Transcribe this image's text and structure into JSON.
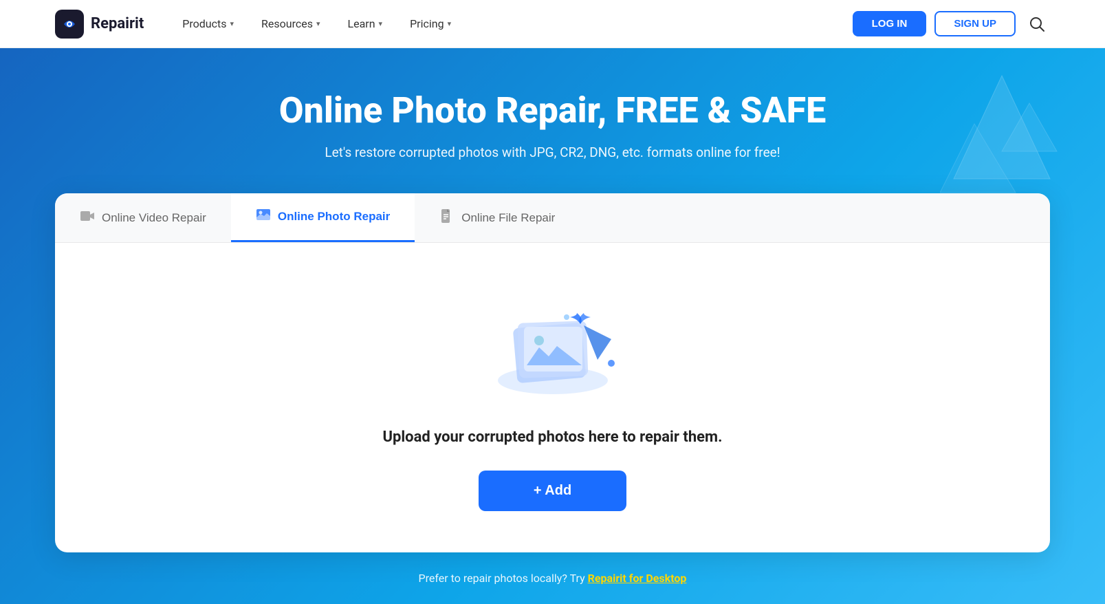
{
  "navbar": {
    "brand_name": "Repairit",
    "nav_items": [
      {
        "id": "products",
        "label": "Products",
        "has_dropdown": true
      },
      {
        "id": "resources",
        "label": "Resources",
        "has_dropdown": true
      },
      {
        "id": "learn",
        "label": "Learn",
        "has_dropdown": true
      },
      {
        "id": "pricing",
        "label": "Pricing",
        "has_dropdown": true
      }
    ],
    "login_label": "LOG IN",
    "signup_label": "SIGN UP"
  },
  "hero": {
    "title": "Online Photo Repair, FREE & SAFE",
    "subtitle": "Let's restore corrupted photos with JPG, CR2, DNG, etc. formats online for free!"
  },
  "tabs": [
    {
      "id": "video",
      "label": "Online Video Repair",
      "active": false
    },
    {
      "id": "photo",
      "label": "Online Photo Repair",
      "active": true
    },
    {
      "id": "file",
      "label": "Online File Repair",
      "active": false
    }
  ],
  "card": {
    "upload_text": "Upload your corrupted photos here to repair them.",
    "add_button_label": "+ Add"
  },
  "footer": {
    "text": "Prefer to repair photos locally? Try ",
    "link_text": "Repairit for Desktop"
  }
}
